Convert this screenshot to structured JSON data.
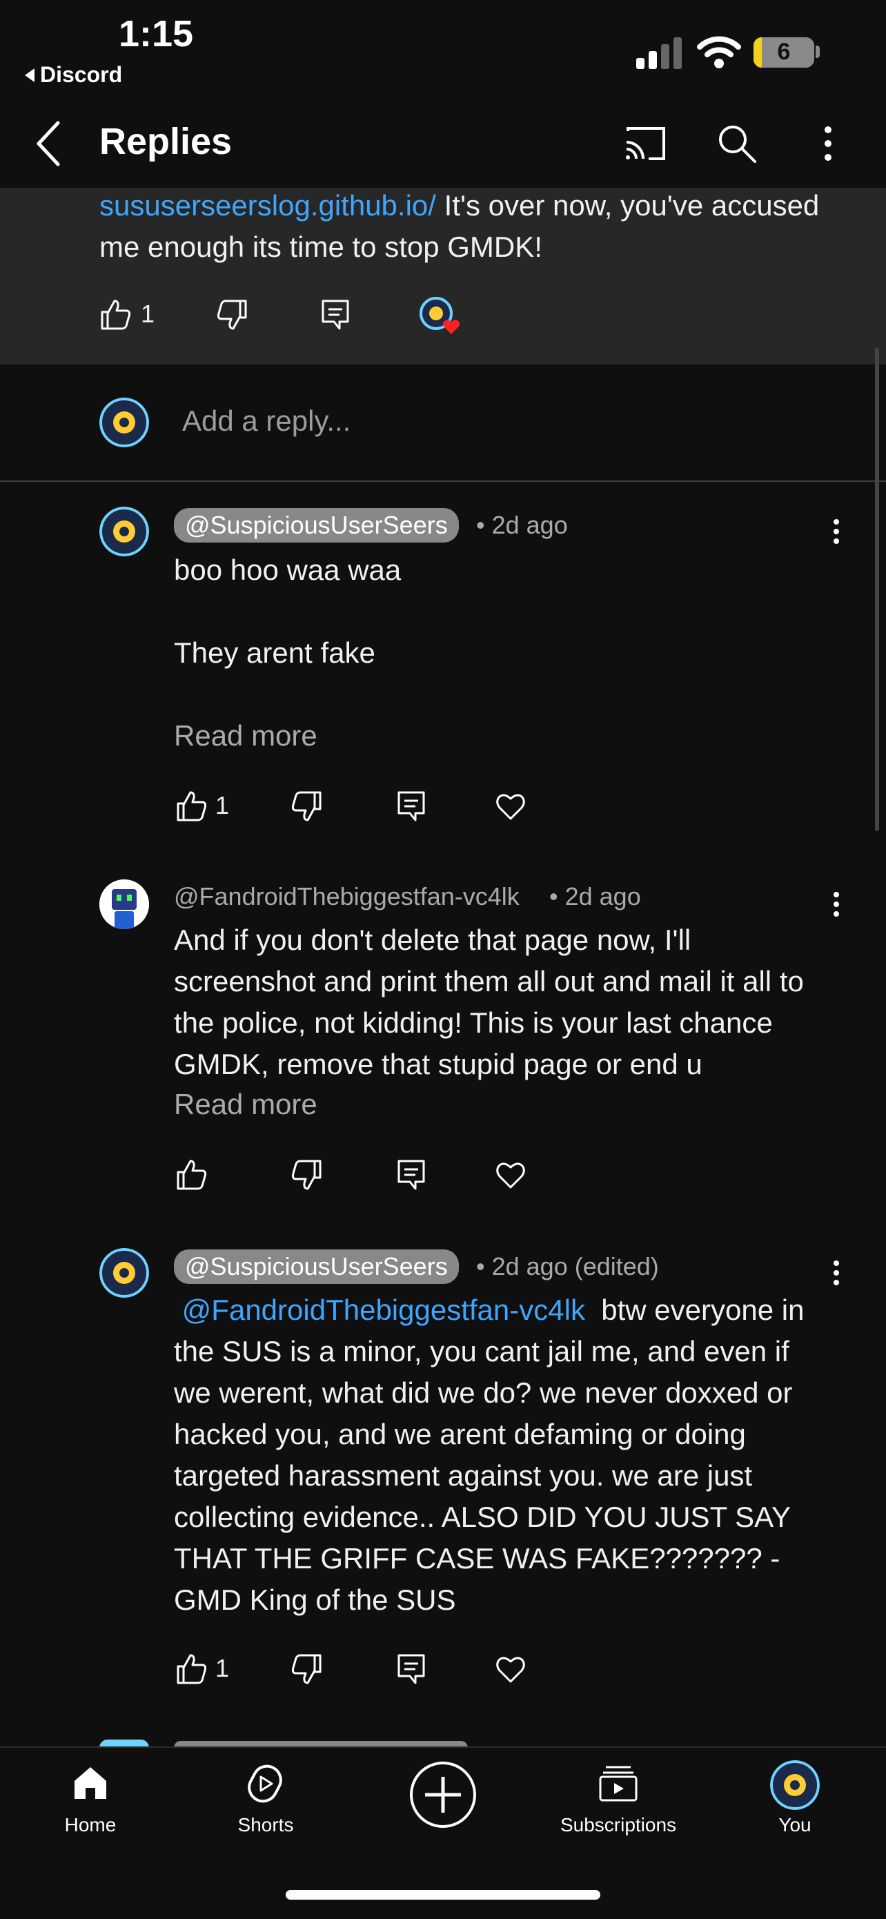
{
  "status_bar": {
    "time": "1:15",
    "back_app": "Discord",
    "battery_level": "6"
  },
  "header": {
    "title": "Replies"
  },
  "parent_comment": {
    "link_text": "sususerseerslog.github.io/",
    "text": " It's over now, you've accused me enough its time to stop GMDK!",
    "like_count": "1"
  },
  "reply_input": {
    "placeholder": "Add a reply..."
  },
  "replies": [
    {
      "author": "@SuspiciousUserSeers",
      "time": "• 2d ago",
      "body": "boo hoo waa waa\n\nThey arent fake",
      "read_more": "Read more",
      "like_count": "1"
    },
    {
      "author": "@FandroidThebiggestfan-vc4lk",
      "time": "• 2d ago",
      "body": "And if you don't delete that page now, I'll screenshot and print them all out and mail it all to the police, not kidding! This is your last chance GMDK, remove that stupid page or end u",
      "read_more": "Read more",
      "like_count": ""
    },
    {
      "author": "@SuspiciousUserSeers",
      "time": "• 2d ago (edited)",
      "mention": " @FandroidThebiggestfan-vc4lk ",
      "body": " btw everyone in the SUS is a minor, you cant jail me, and even if we werent, what did we do? we never doxxed or hacked you, and we arent defaming or doing targeted harassment against you. we are just collecting evidence.. ALSO DID YOU JUST SAY THAT THE GRIFF CASE WAS FAKE??????? -GMD King of the SUS",
      "like_count": "1"
    }
  ],
  "bottom_nav": {
    "home": "Home",
    "shorts": "Shorts",
    "subscriptions": "Subscriptions",
    "you": "You"
  },
  "colors": {
    "background": "#0f0f0f",
    "highlight": "#272727",
    "link": "#3ea6ff",
    "muted": "#aaaaaa"
  }
}
